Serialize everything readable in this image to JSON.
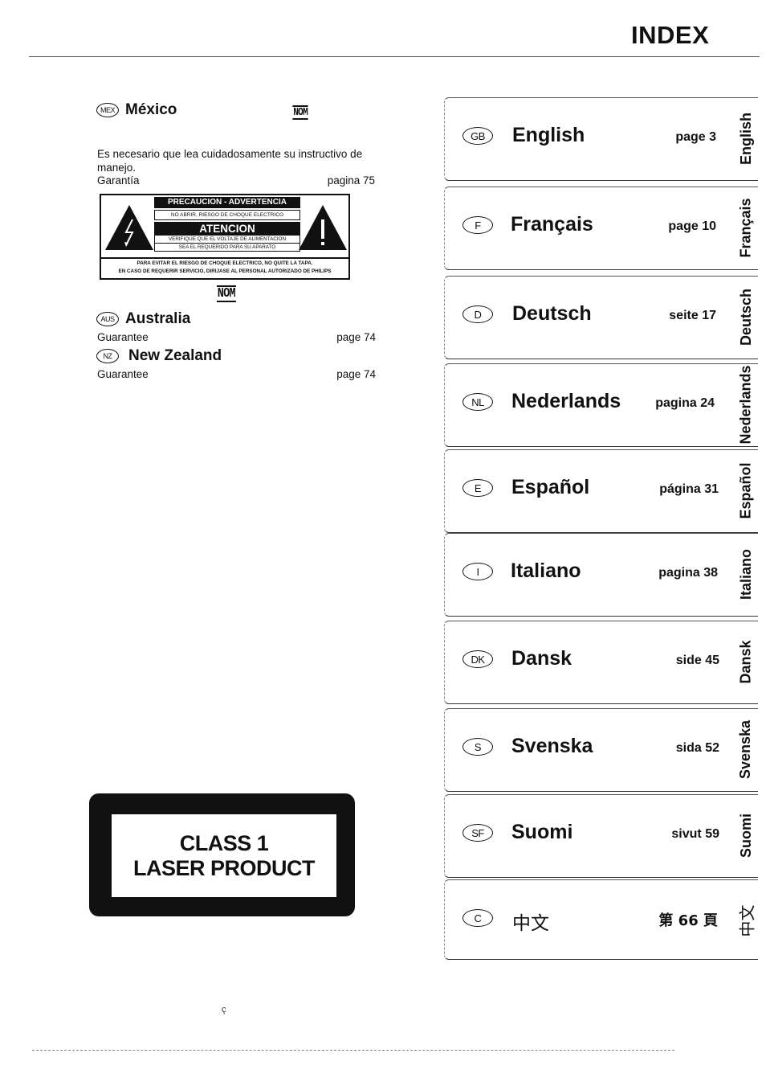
{
  "header": {
    "title": "INDEX"
  },
  "left": {
    "mexico": {
      "badge": "MEX",
      "name": "México",
      "nom_mark": "NOM",
      "instruction": "Es necesario que lea cuidadosamente su instructivo de manejo.",
      "guarantee_label": "Garantía",
      "guarantee_page": "pagina 75"
    },
    "warning_label": {
      "header": "PRECAUCION - ADVERTENCIA",
      "line1": "NO ABRIR, RIESGO DE CHOQUE ELECTRICO",
      "atencion": "ATENCION",
      "line2": "VERIFIQUE QUE EL VOLTAJE DE ALIMENTACION",
      "line3": "SEA EL REQUERIDO PARA SU APARATO",
      "footer1": "PARA EVITAR EL RIESGO DE CHOQUE ELECTRICO, NO QUITE LA TAPA.",
      "footer2": "EN CASO DE REQUERIR SERVICIO, DIRIJASE AL PERSONAL AUTORIZADO DE PHILIPS",
      "left_icon": "lightning-warning-icon",
      "right_icon": "exclamation-warning-icon"
    },
    "nom_mark_2": "NOM",
    "australia": {
      "badge": "AUS",
      "name": "Australia",
      "guarantee_label": "Guarantee",
      "guarantee_page": "page 74"
    },
    "new_zealand": {
      "badge": "NZ",
      "name": "New Zealand",
      "guarantee_label": "Guarantee",
      "guarantee_page": "page 74"
    },
    "laser_label": {
      "line1": "CLASS 1",
      "line2": "LASER PRODUCT"
    }
  },
  "languages": [
    {
      "badge": "GB",
      "name": "English",
      "page": "page 3",
      "tab": "English"
    },
    {
      "badge": "F",
      "name": "Français",
      "page": "page 10",
      "tab": "Français"
    },
    {
      "badge": "D",
      "name": "Deutsch",
      "page": "seite 17",
      "tab": "Deutsch"
    },
    {
      "badge": "NL",
      "name": "Nederlands",
      "page": "pagina 24",
      "tab": "Nederlands"
    },
    {
      "badge": "E",
      "name": "Español",
      "page": "página 31",
      "tab": "Español"
    },
    {
      "badge": "I",
      "name": "Italiano",
      "page": "pagina 38",
      "tab": "Italiano"
    },
    {
      "badge": "DK",
      "name": "Dansk",
      "page": "side 45",
      "tab": "Dansk"
    },
    {
      "badge": "S",
      "name": "Svenska",
      "page": "sida 52",
      "tab": "Svenska"
    },
    {
      "badge": "SF",
      "name": "Suomi",
      "page": "sivut 59",
      "tab": "Suomi"
    },
    {
      "badge": "C",
      "name": "中文",
      "page": "第 66 頁",
      "tab": "中文"
    }
  ]
}
